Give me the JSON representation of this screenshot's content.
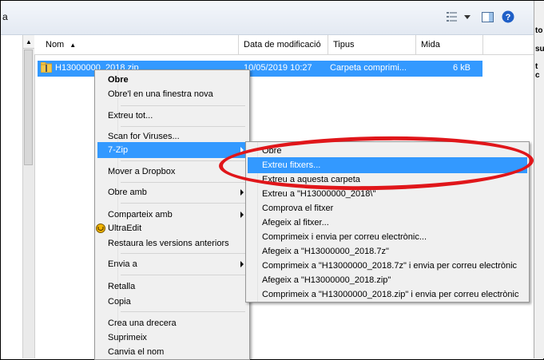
{
  "breadcrumb_fragment": "a",
  "right_panel_fragments": [
    "to",
    "su",
    "t c"
  ],
  "toolbar": {
    "view_icon": "view-options-icon",
    "dropdown_icon": "chevron-down-icon",
    "preview_icon": "preview-pane-icon",
    "help_icon": "help-icon"
  },
  "columns": {
    "name": "Nom",
    "date": "Data de modificació",
    "type": "Tipus",
    "size": "Mida"
  },
  "file": {
    "name": "H13000000_2018.zip",
    "date": "10/05/2019 10:27",
    "type": "Carpeta comprimi...",
    "size": "6 kB"
  },
  "context_menu": {
    "open": "Obre",
    "open_new_window": "Obre'l en una finestra nova",
    "extract_all": "Extreu tot...",
    "scan_viruses": "Scan for Viruses...",
    "seven_zip": "7-Zip",
    "move_dropbox": "Mover a Dropbox",
    "open_with": "Obre amb",
    "share_with": "Comparteix amb",
    "ultraedit": "UltraEdit",
    "restore_versions": "Restaura les versions anteriors",
    "send_to": "Envia a",
    "cut": "Retalla",
    "copy": "Copia",
    "create_shortcut": "Crea una drecera",
    "delete": "Suprimeix",
    "rename": "Canvia el nom"
  },
  "submenu": {
    "open": "Obre",
    "extract_files": "Extreu fitxers...",
    "extract_here": "Extreu a aquesta carpeta",
    "extract_to": "Extreu a \"H13000000_2018\\\"",
    "test_archive": "Comprova el fitxer",
    "add_to_archive": "Afegeix al fitxer...",
    "compress_email": "Comprimeix i envia per correu electrònic...",
    "add_7z": "Afegeix a \"H13000000_2018.7z\"",
    "compress_7z_email": "Comprimeix a \"H13000000_2018.7z\" i envia per correu electrònic",
    "add_zip": "Afegeix a \"H13000000_2018.zip\"",
    "compress_zip_email": "Comprimeix a \"H13000000_2018.zip\" i envia per correu electrònic"
  },
  "colors": {
    "selection": "#3399ff",
    "highlight_ellipse": "#e0161a",
    "menu_bg": "#f0f0f0"
  }
}
